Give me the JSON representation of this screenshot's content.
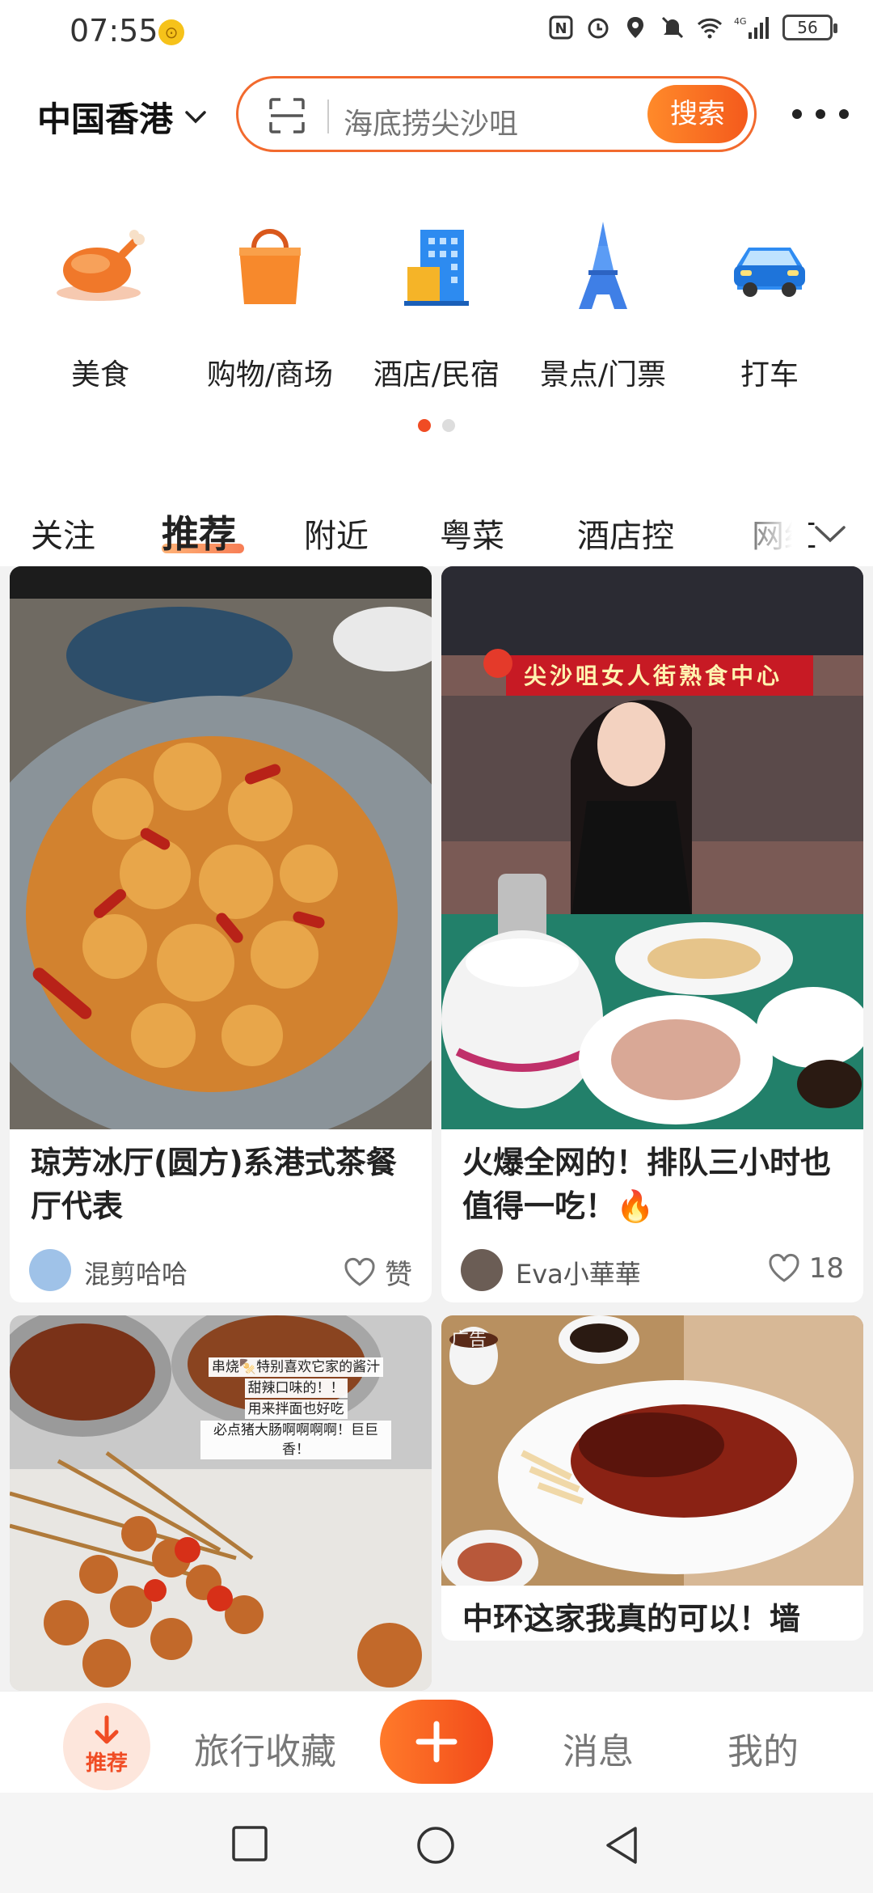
{
  "status": {
    "time": "07:55",
    "network": "4G",
    "battery": "56"
  },
  "header": {
    "city": "中国香港",
    "search_placeholder": "海底捞尖沙咀",
    "search_button": "搜索"
  },
  "categories": [
    {
      "label": "美食",
      "icon": "roast-chicken-icon"
    },
    {
      "label": "购物/商场",
      "icon": "shopping-bag-icon"
    },
    {
      "label": "酒店/民宿",
      "icon": "hotel-building-icon"
    },
    {
      "label": "景点/门票",
      "icon": "eiffel-tower-icon"
    },
    {
      "label": "打车",
      "icon": "car-icon"
    }
  ],
  "tabs": [
    "关注",
    "推荐",
    "附近",
    "粤菜",
    "酒店控",
    "网红"
  ],
  "active_tab": "推荐",
  "feed": [
    {
      "title": "琼芳冰厅(圆方)系港式茶餐厅代表",
      "author": "混剪哈哈",
      "likes": "赞"
    },
    {
      "title": "火爆全网的！排队三小时也值得一吃！🔥",
      "author": "Eva小華華",
      "likes": "18",
      "image_sign": "尖沙咀女人街熟食中心"
    },
    {
      "overlay_lines": [
        "串烧🍢特别喜欢它家的酱汁",
        "甜辣口味的！！",
        "用来拌面也好吃",
        "必点猪大肠啊啊啊啊！巨巨香！"
      ]
    },
    {
      "ad_label": "广告",
      "title": "中环这家我真的可以！墙"
    }
  ],
  "bottom_nav": {
    "home": "推荐",
    "favorites": "旅行收藏",
    "messages": "消息",
    "me": "我的"
  },
  "colors": {
    "accent": "#f04c24",
    "accent_light": "#ff8a2a"
  }
}
